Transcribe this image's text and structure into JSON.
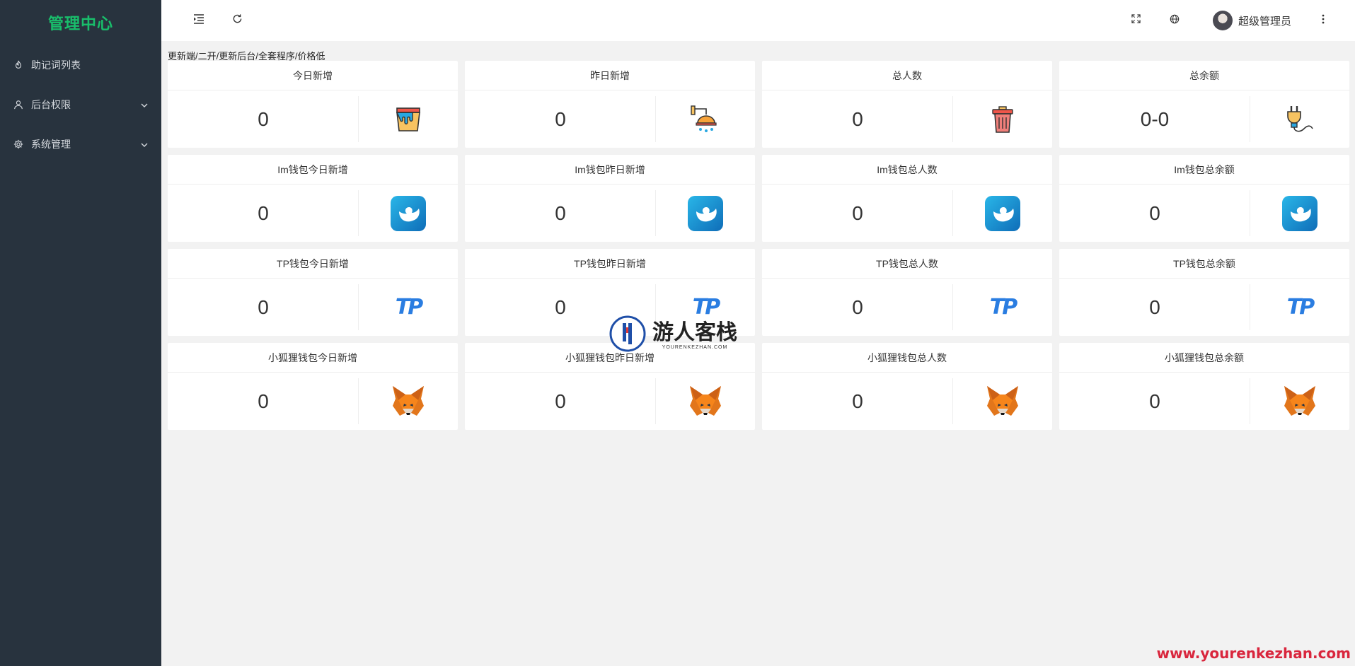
{
  "sidebar": {
    "brand": "管理中心",
    "items": [
      {
        "label": "助记词列表",
        "icon": "fire-icon"
      },
      {
        "label": "后台权限",
        "icon": "user-icon"
      },
      {
        "label": "系统管理",
        "icon": "gear-icon"
      }
    ]
  },
  "header": {
    "user_name": "超级管理员"
  },
  "notice": "更新端/二开/更新后台/全套程序/价格低",
  "cards": [
    {
      "title": "今日新增",
      "value": "0",
      "icon": "paint-bucket-icon"
    },
    {
      "title": "昨日新增",
      "value": "0",
      "icon": "shower-icon"
    },
    {
      "title": "总人数",
      "value": "0",
      "icon": "trash-can-icon"
    },
    {
      "title": "总余额",
      "value": "0-0",
      "icon": "plug-icon"
    },
    {
      "title": "Im钱包今日新增",
      "value": "0",
      "icon": "imtoken-icon"
    },
    {
      "title": "Im钱包昨日新增",
      "value": "0",
      "icon": "imtoken-icon"
    },
    {
      "title": "Im钱包总人数",
      "value": "0",
      "icon": "imtoken-icon"
    },
    {
      "title": "Im钱包总余额",
      "value": "0",
      "icon": "imtoken-icon"
    },
    {
      "title": "TP钱包今日新增",
      "value": "0",
      "icon": "tp-icon",
      "icon_text": "TP"
    },
    {
      "title": "TP钱包昨日新增",
      "value": "0",
      "icon": "tp-icon",
      "icon_text": "TP"
    },
    {
      "title": "TP钱包总人数",
      "value": "0",
      "icon": "tp-icon",
      "icon_text": "TP"
    },
    {
      "title": "TP钱包总余额",
      "value": "0",
      "icon": "tp-icon",
      "icon_text": "TP"
    },
    {
      "title": "小狐狸钱包今日新增",
      "value": "0",
      "icon": "metamask-fox-icon"
    },
    {
      "title": "小狐狸钱包昨日新增",
      "value": "0",
      "icon": "metamask-fox-icon"
    },
    {
      "title": "小狐狸钱包总人数",
      "value": "0",
      "icon": "metamask-fox-icon"
    },
    {
      "title": "小狐狸钱包总余额",
      "value": "0",
      "icon": "metamask-fox-icon"
    }
  ],
  "watermark": {
    "cn": "游人客栈",
    "en": "YOURENKEZHAN.COM",
    "url": "www.yourenkezhan.com"
  },
  "colors": {
    "sidebar_bg": "#28333e",
    "brand": "#19be6b",
    "tp_blue": "#2a7de1",
    "imtoken_blue": "#1a86d0",
    "fox_orange": "#e2761b",
    "watermark_red": "#d9263d"
  }
}
